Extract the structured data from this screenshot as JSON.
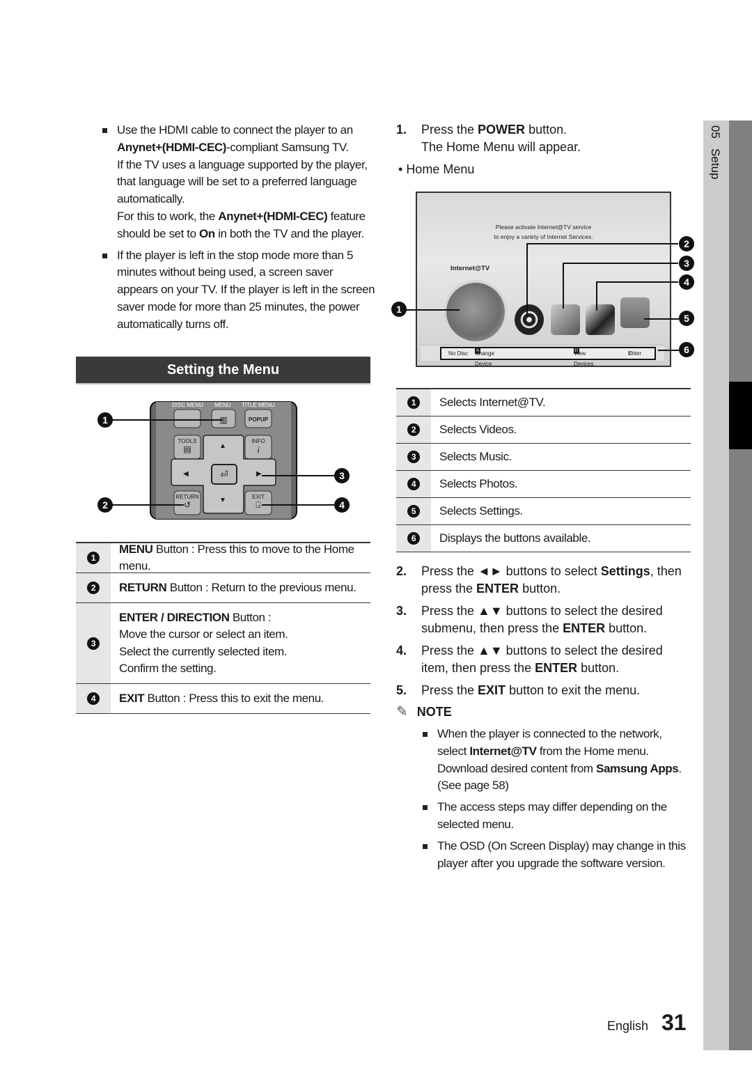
{
  "left_bullets": [
    {
      "p1_pre": "Use the HDMI cable to connect the player to an ",
      "p1_bold": "Anynet+(HDMI-CEC)",
      "p1_post": "-compliant Samsung TV.",
      "p2": "If the TV uses a language supported by the player, that language will be set to a preferred language automatically.",
      "p3_pre": "For this to work, the ",
      "p3_bold": "Anynet+(HDMI-CEC)",
      "p3_mid": " feature should be set to ",
      "p3_bold2": "On",
      "p3_post": " in both the TV and the player."
    },
    {
      "p1": "If the player is left in the stop mode more than 5 minutes without being used, a screen saver appears on your TV. If the player is left in the screen saver mode for more than 25 minutes, the power automatically turns off."
    }
  ],
  "section_title": "Setting the Menu",
  "remote": {
    "buttons": {
      "disc_menu": "DISC MENU",
      "menu": "MENU",
      "title_menu": "TITLE MENU",
      "popup": "POPUP",
      "tools": "TOOLS",
      "info": "INFO",
      "return": "RETURN",
      "exit": "EXIT"
    },
    "icons": {
      "up": "▲",
      "down": "▼",
      "left": "◀",
      "right": "▶",
      "menu": "▥",
      "tools": "▤",
      "info": "i",
      "return": "↺",
      "exit": "⍈",
      "enter": "⏎"
    },
    "callouts": [
      "1",
      "2",
      "3",
      "4"
    ]
  },
  "remote_table": [
    {
      "num": "1",
      "bold": "MENU",
      "text": " Button : Press this to move to the Home menu."
    },
    {
      "num": "2",
      "bold": "RETURN",
      "text": " Button : Return to the previous menu."
    },
    {
      "num": "3",
      "bold": "ENTER / DIRECTION",
      "text": " Button :",
      "lines": [
        "Move the cursor or select an item.",
        "Select the currently selected item.",
        "Confirm the setting."
      ]
    },
    {
      "num": "4",
      "bold": "EXIT",
      "text": " Button : Press this to exit the menu."
    }
  ],
  "steps": {
    "s1": {
      "n": "1.",
      "pre": "Press the ",
      "bold": "POWER",
      "post": " button.",
      "line2": "The Home Menu will appear."
    },
    "home_menu_label": "Home Menu",
    "s2": {
      "n": "2.",
      "pre": "Press the ◄► buttons to select ",
      "bold": "Settings",
      "mid": ", then press the ",
      "bold2": "ENTER",
      "post": " button."
    },
    "s3": {
      "n": "3.",
      "pre": "Press the ▲▼ buttons to select the desired submenu, then press the ",
      "bold": "ENTER",
      "post": " button."
    },
    "s4": {
      "n": "4.",
      "pre": "Press the ▲▼ buttons to select the desired item, then press the ",
      "bold": "ENTER",
      "post": " button."
    },
    "s5": {
      "n": "5.",
      "pre": "Press the ",
      "bold": "EXIT",
      "post": " button to exit the menu."
    }
  },
  "osd": {
    "message_line1": "Please activate Internet@TV service",
    "message_line2": "to enjoy a variety of Internet Services.",
    "internet_tv_label": "Internet@TV",
    "bar": {
      "no_disc": "No Disc",
      "key_a": "A",
      "change_device": "Change Device",
      "key_d": "D",
      "view_devices": "View Devices",
      "enter": "Enter"
    },
    "callouts": [
      "1",
      "2",
      "3",
      "4",
      "5",
      "6"
    ]
  },
  "home_table": [
    {
      "num": "1",
      "text": "Selects Internet@TV."
    },
    {
      "num": "2",
      "text": "Selects Videos."
    },
    {
      "num": "3",
      "text": "Selects Music."
    },
    {
      "num": "4",
      "text": "Selects Photos."
    },
    {
      "num": "5",
      "text": "Selects Settings."
    },
    {
      "num": "6",
      "text": "Displays the buttons available."
    }
  ],
  "note": {
    "title": "NOTE",
    "icon": "✎",
    "items": [
      {
        "pre": "When the player is connected to the network, select ",
        "bold": "Internet@TV",
        "post": " from the Home menu.",
        "line2_pre": "Download desired content from ",
        "line2_bold": "Samsung Apps",
        "line2_post": ". (See page 58)"
      },
      {
        "text": "The access steps may differ depending on the selected menu."
      },
      {
        "text": "The OSD (On Screen Display) may change in this player after you upgrade the software version."
      }
    ]
  },
  "side_tab": {
    "chapter": "05",
    "label": "Setup"
  },
  "footer": {
    "language": "English",
    "page": "31"
  },
  "colors": {
    "header_bg": "#3a3a3a",
    "table_num_bg": "#e6e6e6",
    "side_light": "#cccccc",
    "side_dark": "#808080"
  }
}
